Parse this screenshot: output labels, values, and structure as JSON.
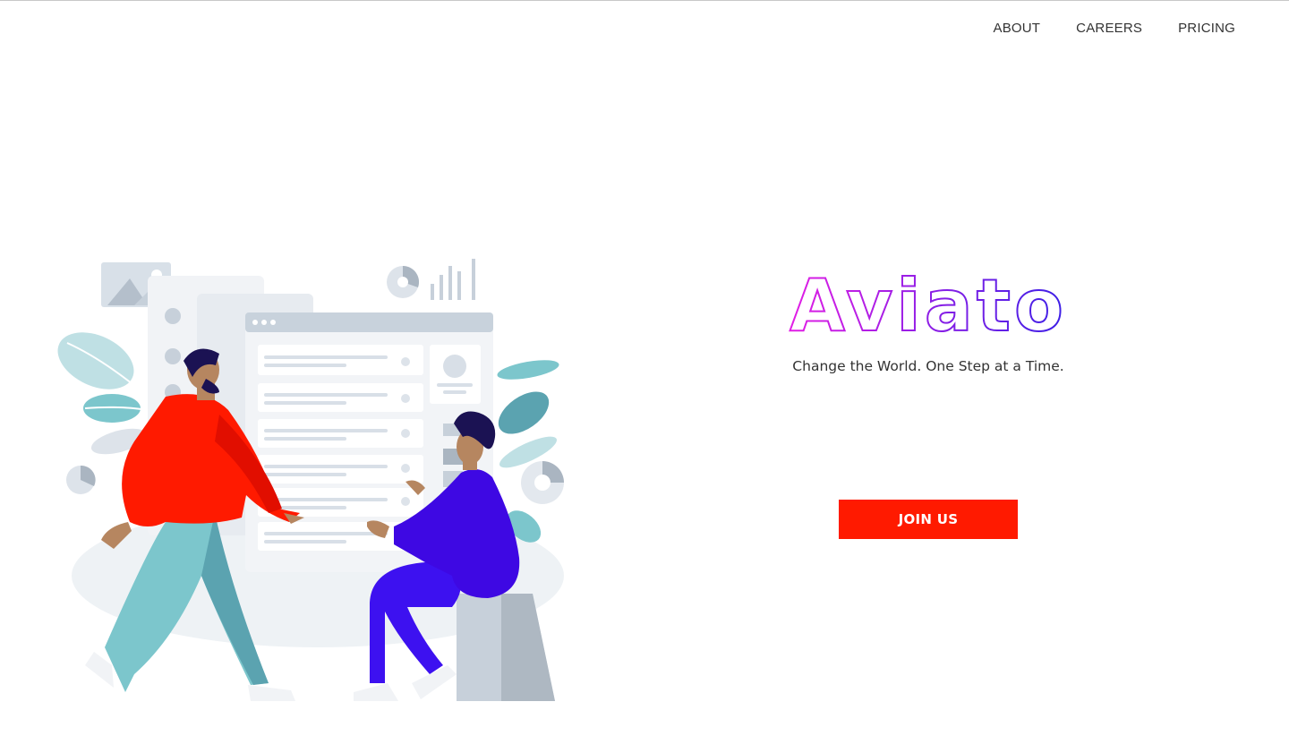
{
  "nav": {
    "items": [
      {
        "label": "ABOUT"
      },
      {
        "label": "CAREERS"
      },
      {
        "label": "PRICING"
      }
    ]
  },
  "hero": {
    "logo_text": "Aviato",
    "tagline": "Change the World. One Step at a Time.",
    "cta_label": "JOIN US"
  },
  "colors": {
    "accent": "#ff1a00",
    "logo_gradient_start": "#e21ee5",
    "logo_gradient_end": "#3b1fe6",
    "text": "#333333"
  },
  "illustration": {
    "icon": "team-collaboration-illustration"
  }
}
